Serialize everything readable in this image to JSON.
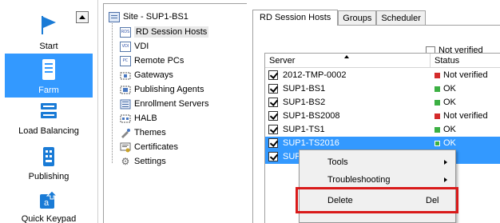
{
  "nav": {
    "items": [
      {
        "label": "Start",
        "icon": "flag-icon"
      },
      {
        "label": "Farm",
        "icon": "server-icon",
        "active": true
      },
      {
        "label": "Load Balancing",
        "icon": "load-balancing-icon"
      },
      {
        "label": "Publishing",
        "icon": "publishing-icon"
      },
      {
        "label": "Quick Keypad",
        "icon": "keypad-icon"
      }
    ]
  },
  "tree": {
    "root": "Site - SUP1-BS1",
    "items": [
      {
        "label": "RD Session Hosts",
        "badge": "RDS",
        "selected": true
      },
      {
        "label": "VDI",
        "badge": "VDI"
      },
      {
        "label": "Remote PCs",
        "badge": "PC"
      },
      {
        "label": "Gateways"
      },
      {
        "label": "Publishing Agents"
      },
      {
        "label": "Enrollment Servers"
      },
      {
        "label": "HALB"
      },
      {
        "label": "Themes"
      },
      {
        "label": "Certificates"
      },
      {
        "label": "Settings"
      }
    ]
  },
  "tabs": [
    {
      "label": "RD Session Hosts",
      "active": true
    },
    {
      "label": "Groups"
    },
    {
      "label": "Scheduler"
    }
  ],
  "filter": {
    "label": "Not verified"
  },
  "grid": {
    "columns": {
      "server": "Server",
      "status": "Status"
    },
    "rows": [
      {
        "server": "2012-TMP-0002",
        "status": "Not verified",
        "color": "#d42b2b"
      },
      {
        "server": "SUP1-BS1",
        "status": "OK",
        "color": "#3cb043"
      },
      {
        "server": "SUP1-BS2",
        "status": "OK",
        "color": "#3cb043"
      },
      {
        "server": "SUP1-BS2008",
        "status": "Not verified",
        "color": "#d42b2b"
      },
      {
        "server": "SUP1-TS1",
        "status": "OK",
        "color": "#3cb043"
      },
      {
        "server": "SUP1-TS2016",
        "status": "OK",
        "color": "#3cb043",
        "selected": true
      },
      {
        "server": "SUP",
        "status": "",
        "color": "",
        "selected": true
      }
    ]
  },
  "context_menu": {
    "tools": "Tools",
    "troubleshooting": "Troubleshooting",
    "delete": "Delete",
    "delete_shortcut": "Del"
  },
  "colors": {
    "selection": "#3399ff",
    "highlight_border": "#d91a1a",
    "ok": "#3cb043",
    "not_verified": "#d42b2b"
  }
}
